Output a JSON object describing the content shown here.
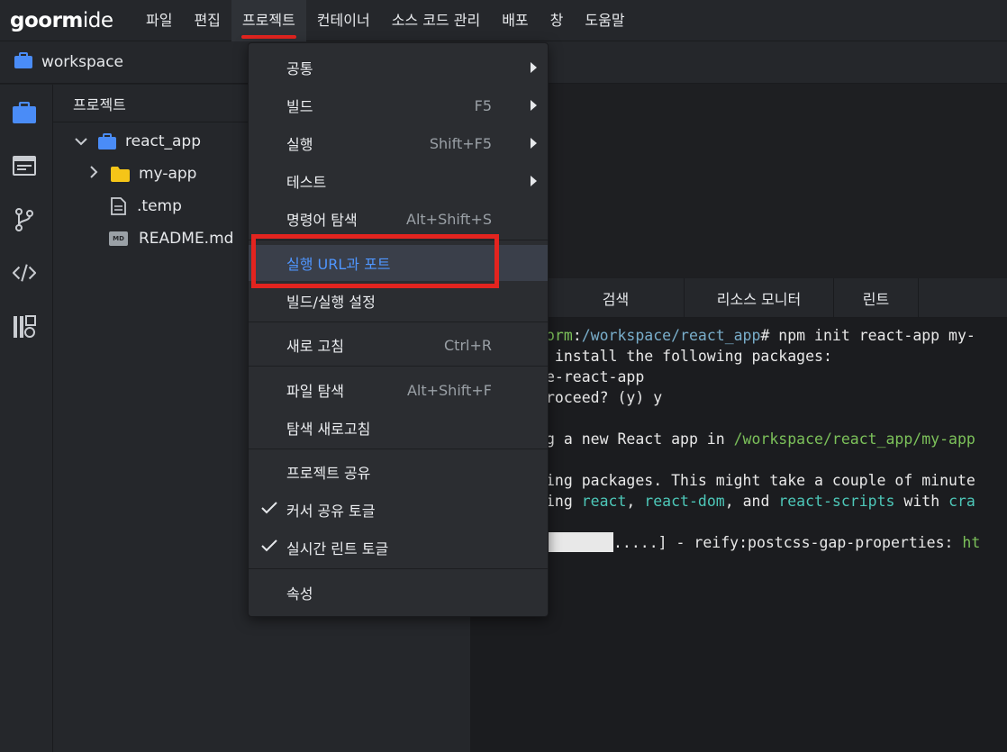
{
  "app": {
    "logo_main": "goorm",
    "logo_ide": "ide"
  },
  "menubar": {
    "items": [
      {
        "label": "파일"
      },
      {
        "label": "편집"
      },
      {
        "label": "프로젝트"
      },
      {
        "label": "컨테이너"
      },
      {
        "label": "소스 코드 관리"
      },
      {
        "label": "배포"
      },
      {
        "label": "창"
      },
      {
        "label": "도움말"
      }
    ],
    "active_index": 2
  },
  "workspace": {
    "label": "workspace"
  },
  "activity_bar": {
    "icons": [
      "briefcase-icon",
      "browser-window-icon",
      "git-branch-icon",
      "code-icon",
      "plugins-icon"
    ]
  },
  "explorer": {
    "title": "프로젝트",
    "tree": [
      {
        "label": "react_app",
        "icon": "briefcase-icon",
        "expanded": true
      },
      {
        "label": "my-app",
        "icon": "folder-icon",
        "expanded": false
      },
      {
        "label": ".temp",
        "icon": "file-icon"
      },
      {
        "label": "README.md",
        "icon": "markdown-icon",
        "badge": "MD"
      }
    ]
  },
  "bottom_tabs": [
    {
      "label": "",
      "icon": "refresh-icon"
    },
    {
      "label": "검색"
    },
    {
      "label": "리소스 모니터"
    },
    {
      "label": "린트"
    }
  ],
  "terminal": {
    "lines": [
      {
        "parts": [
          {
            "t": "orm",
            "c": "green"
          },
          {
            "t": ":",
            "c": ""
          },
          {
            "t": "/workspace/react_app",
            "c": "path"
          },
          {
            "t": "# npm init react-app my-",
            "c": ""
          }
        ]
      },
      {
        "parts": [
          {
            "t": " install the following packages:",
            "c": ""
          }
        ]
      },
      {
        "parts": [
          {
            "t": "e-react-app",
            "c": ""
          }
        ]
      },
      {
        "parts": [
          {
            "t": "roceed? (y) y",
            "c": ""
          }
        ]
      },
      {
        "parts": [
          {
            "t": "",
            "c": ""
          }
        ]
      },
      {
        "parts": [
          {
            "t": "g a new React app in ",
            "c": ""
          },
          {
            "t": "/workspace/react_app/my-app",
            "c": "green"
          }
        ]
      },
      {
        "parts": [
          {
            "t": "",
            "c": ""
          }
        ]
      },
      {
        "parts": [
          {
            "t": "ing packages. This might take a couple of minute",
            "c": ""
          }
        ]
      },
      {
        "parts": [
          {
            "t": "ing ",
            "c": ""
          },
          {
            "t": "react",
            "c": "teal"
          },
          {
            "t": ", ",
            "c": ""
          },
          {
            "t": "react-dom",
            "c": "teal"
          },
          {
            "t": ", and ",
            "c": ""
          },
          {
            "t": "react-scripts",
            "c": "teal"
          },
          {
            "t": " with ",
            "c": ""
          },
          {
            "t": "cra",
            "c": "teal"
          }
        ]
      },
      {
        "parts": [
          {
            "t": "",
            "c": ""
          }
        ]
      },
      {
        "parts": [
          {
            "t": "BAR",
            "c": "bar"
          },
          {
            "t": ".....] - reify:postcss-gap-properties: ",
            "c": ""
          },
          {
            "t": "ht",
            "c": "green"
          }
        ]
      }
    ]
  },
  "dropdown": {
    "items": [
      {
        "label": "공통",
        "shortcut": "",
        "submenu": true
      },
      {
        "label": "빌드",
        "shortcut": "F5",
        "submenu": true
      },
      {
        "label": "실행",
        "shortcut": "Shift+F5",
        "submenu": true
      },
      {
        "label": "테스트",
        "shortcut": "",
        "submenu": true
      },
      {
        "label": "명령어 탐색",
        "shortcut": "Alt+Shift+S"
      },
      {
        "label": "실행 URL과 포트",
        "shortcut": "",
        "highlighted": true
      },
      {
        "label": "빌드/실행 설정",
        "shortcut": ""
      },
      {
        "label": "새로 고침",
        "shortcut": "Ctrl+R"
      },
      {
        "label": "파일 탐색",
        "shortcut": "Alt+Shift+F"
      },
      {
        "label": "탐색 새로고침",
        "shortcut": ""
      },
      {
        "label": "프로젝트 공유",
        "shortcut": ""
      },
      {
        "label": "커서 공유 토글",
        "shortcut": "",
        "checked": true
      },
      {
        "label": "실시간 린트 토글",
        "shortcut": "",
        "checked": true
      },
      {
        "label": "속성",
        "shortcut": ""
      }
    ]
  },
  "colors": {
    "accent_red": "#e3241f",
    "highlight_blue": "#4f96ff",
    "icon_blue": "#4a8cf7",
    "folder_yellow": "#f5c518"
  }
}
